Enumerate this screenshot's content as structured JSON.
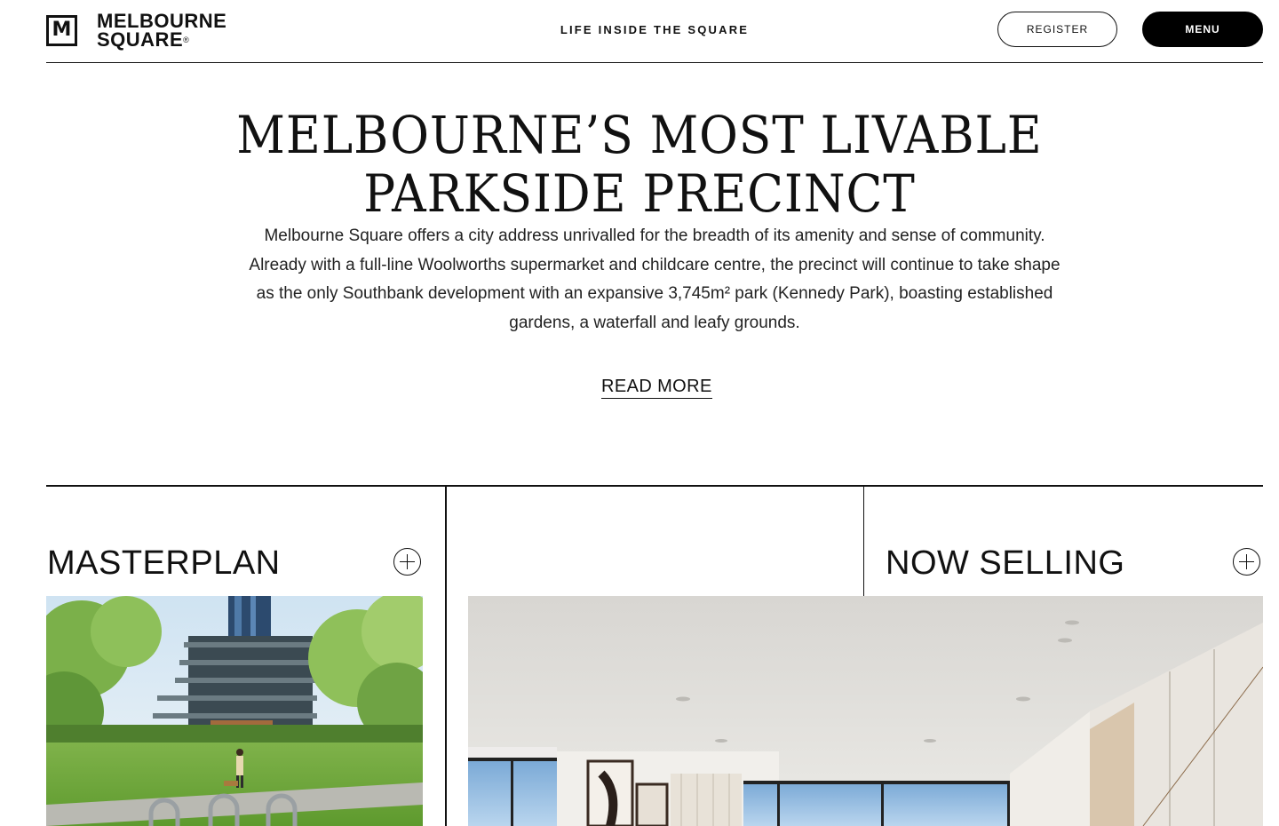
{
  "header": {
    "logo_mark": "M",
    "logo_line1": "MELBOURNE",
    "logo_line2": "SQUARE",
    "logo_reg": "®",
    "tagline": "LIFE INSIDE THE SQUARE",
    "register_label": "REGISTER",
    "menu_label": "MENU"
  },
  "hero": {
    "title_line1": "MELBOURNE’S MOST LIVABLE",
    "title_line2": "PARKSIDE PRECINCT",
    "body": "Melbourne Square offers a city address unrivalled for the breadth of its amenity and sense of community. Already with a full-line Woolworths supermarket and childcare centre, the precinct will continue to take shape as the only Southbank development with an expansive 3,745m² park (Kennedy Park), boasting established gardens, a waterfall and leafy grounds.",
    "read_more": "READ MORE"
  },
  "sections": [
    {
      "title": "MASTERPLAN",
      "icon": "plus-circle-icon"
    },
    {
      "title": "NOW SELLING",
      "icon": "plus-circle-icon"
    }
  ],
  "colors": {
    "text": "#111111",
    "background": "#ffffff",
    "menu_bg": "#000000"
  }
}
